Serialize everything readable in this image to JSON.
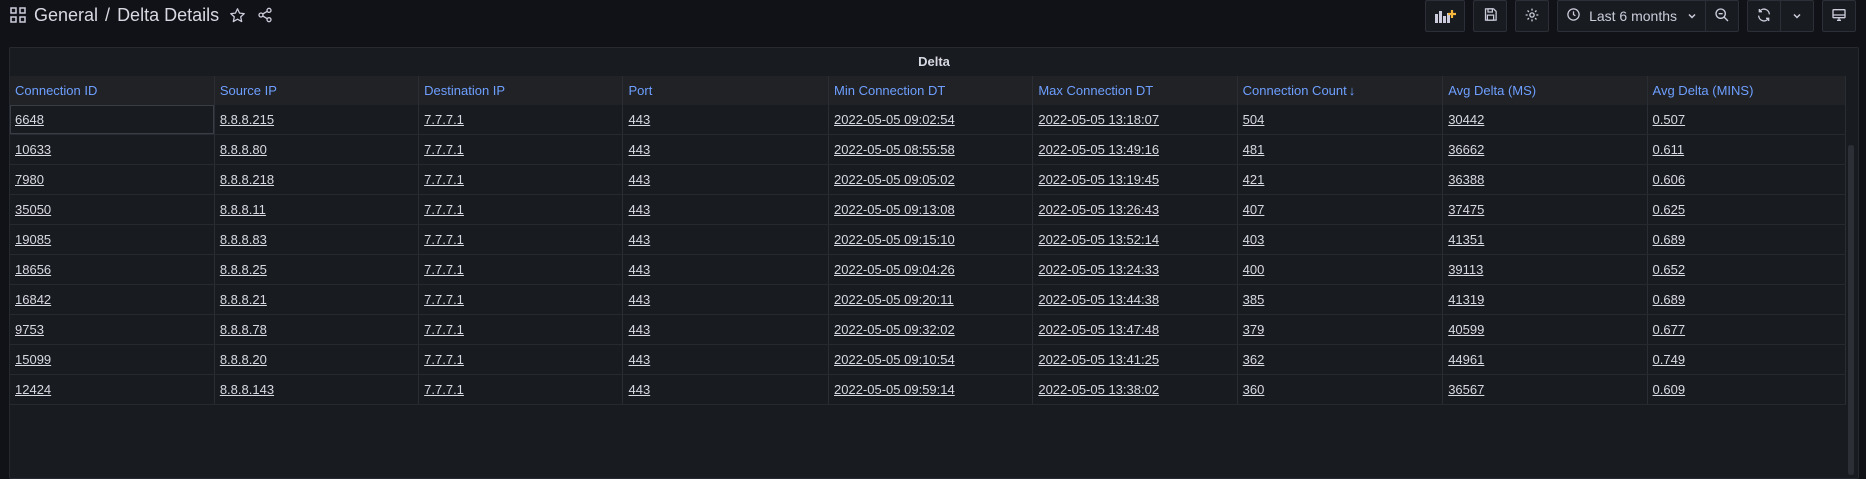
{
  "breadcrumb": {
    "folder": "General",
    "separator": " / ",
    "dashboard": "Delta Details"
  },
  "toolbar": {
    "time_range": "Last 6 months"
  },
  "panel": {
    "title": "Delta",
    "columns": [
      "Connection ID",
      "Source IP",
      "Destination IP",
      "Port",
      "Min Connection DT",
      "Max Connection DT",
      "Connection Count",
      "Avg Delta (MS)",
      "Avg Delta (MINS)"
    ],
    "sort_indicator": "↓",
    "rows": [
      [
        "6648",
        "8.8.8.215",
        "7.7.7.1",
        "443",
        "2022-05-05 09:02:54",
        "2022-05-05 13:18:07",
        "504",
        "30442",
        "0.507"
      ],
      [
        "10633",
        "8.8.8.80",
        "7.7.7.1",
        "443",
        "2022-05-05 08:55:58",
        "2022-05-05 13:49:16",
        "481",
        "36662",
        "0.611"
      ],
      [
        "7980",
        "8.8.8.218",
        "7.7.7.1",
        "443",
        "2022-05-05 09:05:02",
        "2022-05-05 13:19:45",
        "421",
        "36388",
        "0.606"
      ],
      [
        "35050",
        "8.8.8.11",
        "7.7.7.1",
        "443",
        "2022-05-05 09:13:08",
        "2022-05-05 13:26:43",
        "407",
        "37475",
        "0.625"
      ],
      [
        "19085",
        "8.8.8.83",
        "7.7.7.1",
        "443",
        "2022-05-05 09:15:10",
        "2022-05-05 13:52:14",
        "403",
        "41351",
        "0.689"
      ],
      [
        "18656",
        "8.8.8.25",
        "7.7.7.1",
        "443",
        "2022-05-05 09:04:26",
        "2022-05-05 13:24:33",
        "400",
        "39113",
        "0.652"
      ],
      [
        "16842",
        "8.8.8.21",
        "7.7.7.1",
        "443",
        "2022-05-05 09:20:11",
        "2022-05-05 13:44:38",
        "385",
        "41319",
        "0.689"
      ],
      [
        "9753",
        "8.8.8.78",
        "7.7.7.1",
        "443",
        "2022-05-05 09:32:02",
        "2022-05-05 13:47:48",
        "379",
        "40599",
        "0.677"
      ],
      [
        "15099",
        "8.8.8.20",
        "7.7.7.1",
        "443",
        "2022-05-05 09:10:54",
        "2022-05-05 13:41:25",
        "362",
        "44961",
        "0.749"
      ],
      [
        "12424",
        "8.8.8.143",
        "7.7.7.1",
        "443",
        "2022-05-05 09:59:14",
        "2022-05-05 13:38:02",
        "360",
        "36567",
        "0.609"
      ]
    ]
  },
  "colors": {
    "background": "#111217",
    "panel": "#181b1f",
    "header_text": "#6e9fff",
    "add_panel_accent": "#f5b73d"
  }
}
